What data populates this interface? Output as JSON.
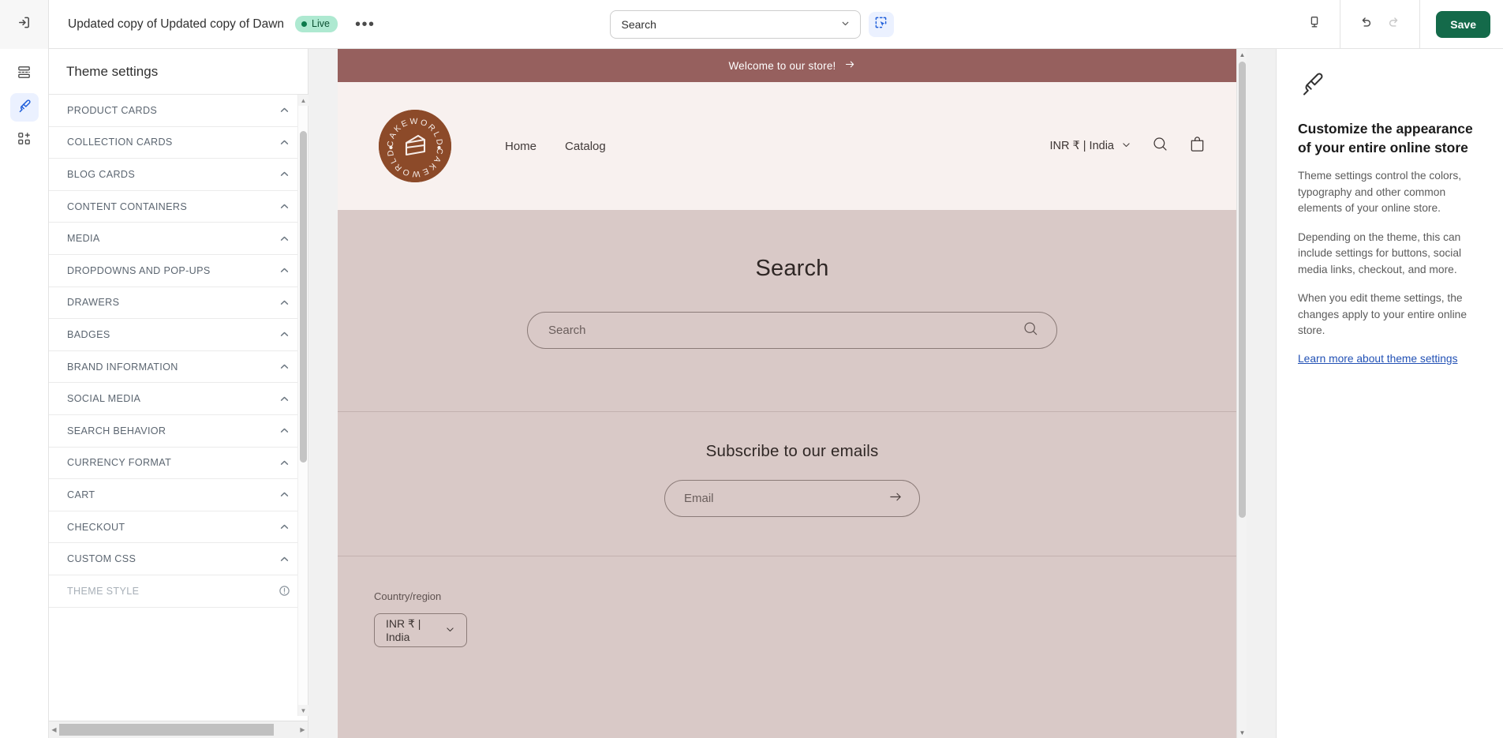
{
  "topbar": {
    "exit_icon": "exit-arrow-icon",
    "theme_title": "Updated copy of Updated copy of Dawn",
    "live_badge": "Live",
    "more_label": "•••",
    "page_select_value": "Search",
    "inspector_icon": "cursor-select-icon",
    "device_icon": "desktop-device-icon",
    "undo_icon": "undo-icon",
    "redo_icon": "redo-icon",
    "save_label": "Save",
    "accents": {
      "save_green": "#146A4A",
      "active_blue": "#EBF1FF",
      "live_green": "#AEE9D1"
    }
  },
  "rail": {
    "items": [
      {
        "name": "sections-icon",
        "label": "Sections",
        "active": false
      },
      {
        "name": "paintbrush-icon",
        "label": "Theme settings",
        "active": true
      },
      {
        "name": "apps-add-icon",
        "label": "Apps",
        "active": false
      }
    ]
  },
  "sidebar": {
    "title": "Theme settings",
    "items": [
      {
        "label": "PRODUCT CARDS",
        "icon": "chevron-up-icon",
        "muted": false
      },
      {
        "label": "COLLECTION CARDS",
        "icon": "chevron-up-icon",
        "muted": false
      },
      {
        "label": "BLOG CARDS",
        "icon": "chevron-up-icon",
        "muted": false
      },
      {
        "label": "CONTENT CONTAINERS",
        "icon": "chevron-up-icon",
        "muted": false
      },
      {
        "label": "MEDIA",
        "icon": "chevron-up-icon",
        "muted": false
      },
      {
        "label": "DROPDOWNS AND POP-UPS",
        "icon": "chevron-up-icon",
        "muted": false
      },
      {
        "label": "DRAWERS",
        "icon": "chevron-up-icon",
        "muted": false
      },
      {
        "label": "BADGES",
        "icon": "chevron-up-icon",
        "muted": false
      },
      {
        "label": "BRAND INFORMATION",
        "icon": "chevron-up-icon",
        "muted": false
      },
      {
        "label": "SOCIAL MEDIA",
        "icon": "chevron-up-icon",
        "muted": false
      },
      {
        "label": "SEARCH BEHAVIOR",
        "icon": "chevron-up-icon",
        "muted": false
      },
      {
        "label": "CURRENCY FORMAT",
        "icon": "chevron-up-icon",
        "muted": false
      },
      {
        "label": "CART",
        "icon": "chevron-up-icon",
        "muted": false
      },
      {
        "label": "CHECKOUT",
        "icon": "chevron-up-icon",
        "muted": false
      },
      {
        "label": "CUSTOM CSS",
        "icon": "chevron-up-icon",
        "muted": false
      },
      {
        "label": "THEME STYLE",
        "icon": "info-circle-icon",
        "muted": true
      }
    ]
  },
  "preview": {
    "announcement": "Welcome to our store!",
    "announcement_icon": "arrow-right-icon",
    "announcement_bg": "#96605E",
    "logo": {
      "name": "cakeworld-logo",
      "text_top": "CAKEWORLD",
      "text_bottom": "CAKEWORLD",
      "color": "#8C4A29"
    },
    "nav": [
      "Home",
      "Catalog"
    ],
    "currency": "INR ₹ | India",
    "currency_chevron": "chevron-down-icon",
    "header_search_icon": "search-icon",
    "cart_icon": "shopping-bag-icon",
    "page_heading": "Search",
    "search_placeholder": "Search",
    "search_submit_icon": "search-icon",
    "newsletter_title": "Subscribe to our emails",
    "newsletter_placeholder": "Email",
    "newsletter_submit_icon": "arrow-right-icon",
    "footer_country_label": "Country/region",
    "footer_country_value": "INR ₹ | India",
    "footer_country_chevron": "chevron-down-icon",
    "colors": {
      "header_bg": "#F8F1EF",
      "body_bg": "#D9C9C7"
    }
  },
  "infopanel": {
    "icon": "paintbrush-icon",
    "title": "Customize the appearance of your entire online store",
    "paragraphs": [
      "Theme settings control the colors, typography and other common elements of your online store.",
      "Depending on the theme, this can include settings for buttons, social media links, checkout, and more.",
      "When you edit theme settings, the changes apply to your entire online store."
    ],
    "link": "Learn more about theme settings"
  }
}
